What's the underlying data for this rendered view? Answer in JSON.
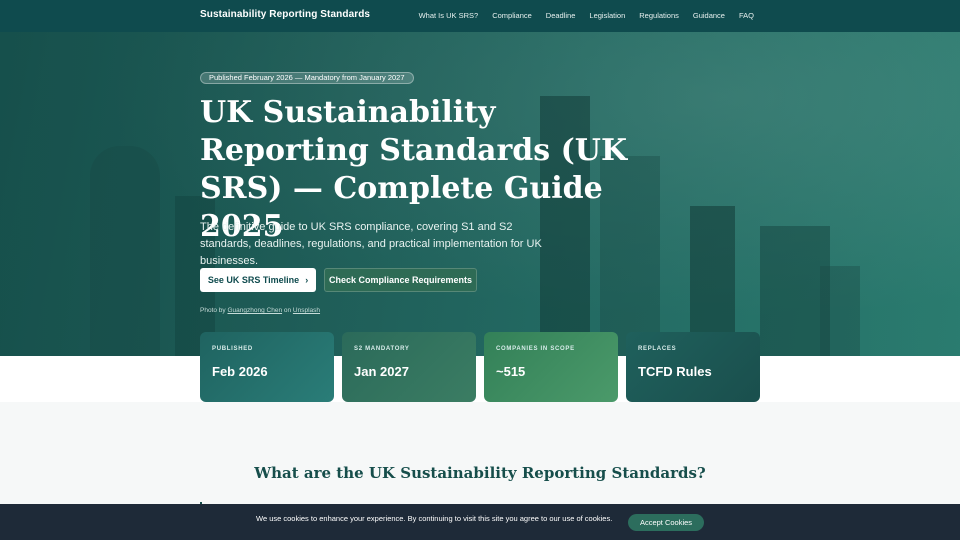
{
  "nav": {
    "brand": "Sustainability Reporting Standards",
    "links": [
      "What Is UK SRS?",
      "Compliance",
      "Deadline",
      "Legislation",
      "Regulations",
      "Guidance",
      "FAQ"
    ]
  },
  "hero": {
    "badge": "Published February 2026 — Mandatory from January 2027",
    "title": "UK Sustainability Reporting Standards (UK SRS) — Complete Guide 2025",
    "subtitle": "The definitive guide to UK SRS compliance, covering S1 and S2 standards, deadlines, regulations, and practical implementation for UK businesses.",
    "primary_button": "See UK SRS Timeline",
    "secondary_button": "Check Compliance Requirements",
    "credit_prefix": "Photo by",
    "credit_author": "Guangzhong Chen",
    "credit_mid": "on",
    "credit_site": "Unsplash"
  },
  "stats": [
    {
      "label": "PUBLISHED",
      "value": "Feb 2026"
    },
    {
      "label": "S2 MANDATORY",
      "value": "Jan 2027"
    },
    {
      "label": "COMPANIES IN SCOPE",
      "value": "~515"
    },
    {
      "label": "REPLACES",
      "value": "TCFD Rules"
    }
  ],
  "section": {
    "heading": "What are the UK Sustainability Reporting Standards?"
  },
  "cookie": {
    "message": "We use cookies to enhance your experience. By continuing to visit this site you agree to our use of cookies.",
    "accept": "Accept Cookies"
  },
  "icons": {
    "timeline_button": "chevron-right-icon"
  }
}
